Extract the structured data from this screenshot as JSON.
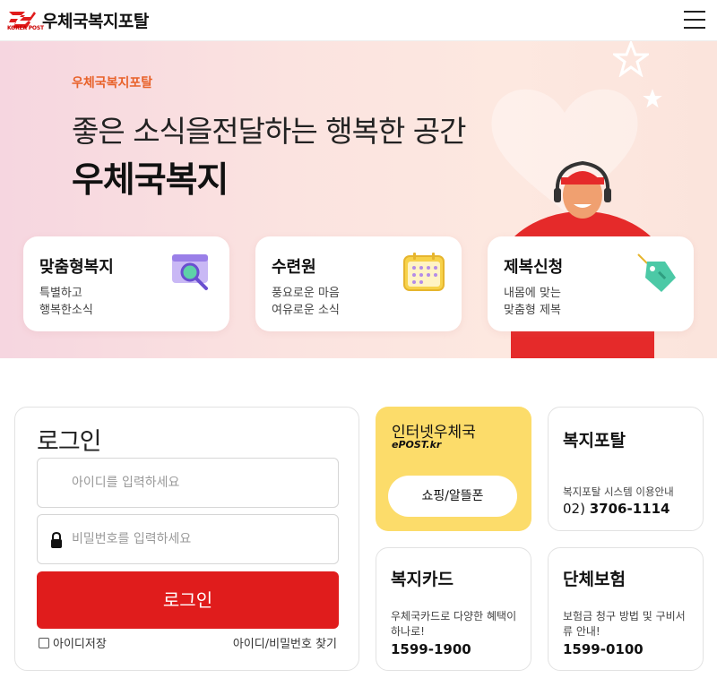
{
  "header": {
    "logo_text": "KOREA POST",
    "brand": "우체국복지포탈"
  },
  "hero": {
    "tag": "우체국복지포탈",
    "line": "좋은 소식을전달하는 행복한 공간",
    "title": "우체국복지",
    "cards": [
      {
        "title": "맞춤형복지",
        "desc": "특별하고\n행복한소식",
        "icon": "search-window-icon"
      },
      {
        "title": "수련원",
        "desc": "풍요로운 마음\n여유로운 소식",
        "icon": "calendar-icon"
      },
      {
        "title": "제복신청",
        "desc": "내몸에 맞는\n맞춤형 제복",
        "icon": "price-tag-icon"
      }
    ]
  },
  "login": {
    "title": "로그인",
    "id_placeholder": "아이디를 입력하세요",
    "pw_placeholder": "비밀번호를 입력하세요",
    "button": "로그인",
    "save_id": "아이디저장",
    "find_link": "아이디/비밀번호 찾기"
  },
  "epost": {
    "title": "인터넷우체국",
    "sub": "ePOST.kr",
    "button": "쇼핑/알뜰폰"
  },
  "tiles": {
    "portal": {
      "title": "복지포탈",
      "desc": "복지포탈 시스템 이용안내",
      "phone_prefix": "02)",
      "phone": "3706-1114"
    },
    "card": {
      "title": "복지카드",
      "desc": "우체국카드로 다양한 혜택이\n하나로!",
      "phone": "1599-1900"
    },
    "insurance": {
      "title": "단체보험",
      "desc": "보험금 청구 방법 및 구비서\n류 안내!",
      "phone": "1599-0100"
    }
  },
  "colors": {
    "accent_red": "#e01c1c",
    "accent_orange": "#e8622a",
    "epost_yellow": "#fcdc6a"
  }
}
